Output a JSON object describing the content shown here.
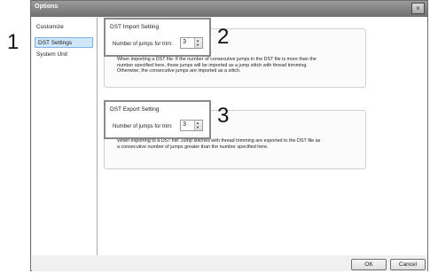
{
  "callouts": {
    "one": "1",
    "two": "2",
    "three": "3"
  },
  "window": {
    "title": "Options",
    "close_icon": "×"
  },
  "sidebar": {
    "items": [
      "Customize",
      "DST Settings",
      "System Unit"
    ]
  },
  "import": {
    "title": "DST Import Setting",
    "label": "Number of jumps for trim:",
    "value": "3",
    "description": [
      "When importing a DST file: If the number of consecutive jumps in the DST file is more than the",
      "number specified here, those jumps will be imported as a jump stitch with thread trimming.",
      "Otherwise, the consecutive jumps are imported as a stitch."
    ]
  },
  "export": {
    "title": "DST Export Setting",
    "label": "Number of jumps for trim:",
    "value": "3",
    "description": [
      "When exporting to a DST file: Jump stitches with thread trimming are exported to the DST file as",
      "a consecutive number of jumps greater than the number specified here."
    ]
  },
  "buttons": {
    "ok": "OK",
    "cancel": "Cancel"
  },
  "icons": {
    "spin_up": "▲",
    "spin_down": "▼"
  }
}
